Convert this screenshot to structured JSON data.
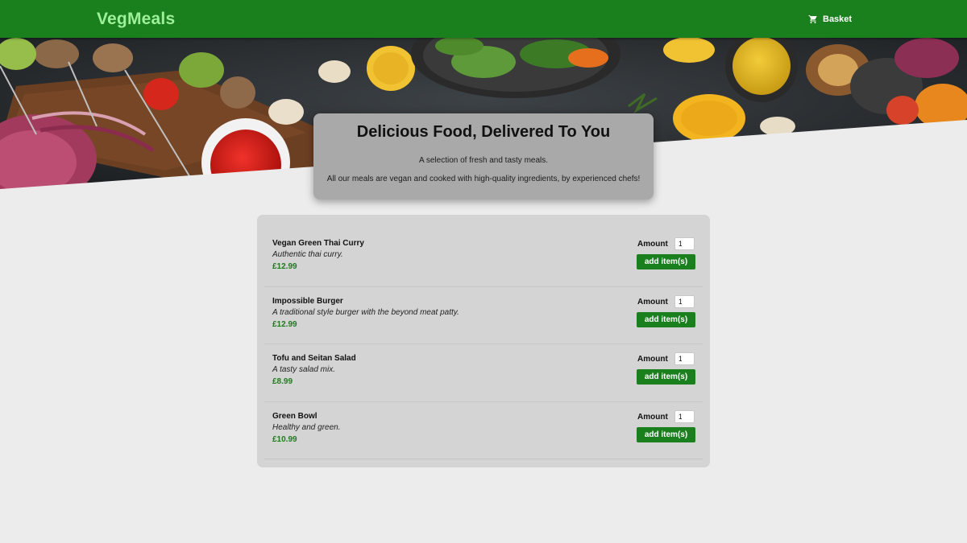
{
  "header": {
    "logo": "VegMeals",
    "basket_label": "Basket",
    "basket_icon": "cart-icon",
    "brand_color": "#1a7f1d",
    "logo_color": "#9ff09a"
  },
  "hero": {
    "title": "Delicious Food, Delivered To You",
    "line1": "A selection of fresh and tasty meals.",
    "line2": "All our meals are vegan and cooked with high-quality ingredients, by experienced chefs!"
  },
  "meals": {
    "amount_label": "Amount",
    "button_label": "add item(s)",
    "items": [
      {
        "name": "Vegan Green Thai Curry",
        "description": "Authentic thai curry.",
        "price": "£12.99",
        "amount": "1"
      },
      {
        "name": "Impossible Burger",
        "description": "A traditional style burger with the beyond meat patty.",
        "price": "£12.99",
        "amount": "1"
      },
      {
        "name": "Tofu and Seitan Salad",
        "description": "A tasty salad mix.",
        "price": "£8.99",
        "amount": "1"
      },
      {
        "name": "Green Bowl",
        "description": "Healthy and green.",
        "price": "£10.99",
        "amount": "1"
      }
    ]
  }
}
